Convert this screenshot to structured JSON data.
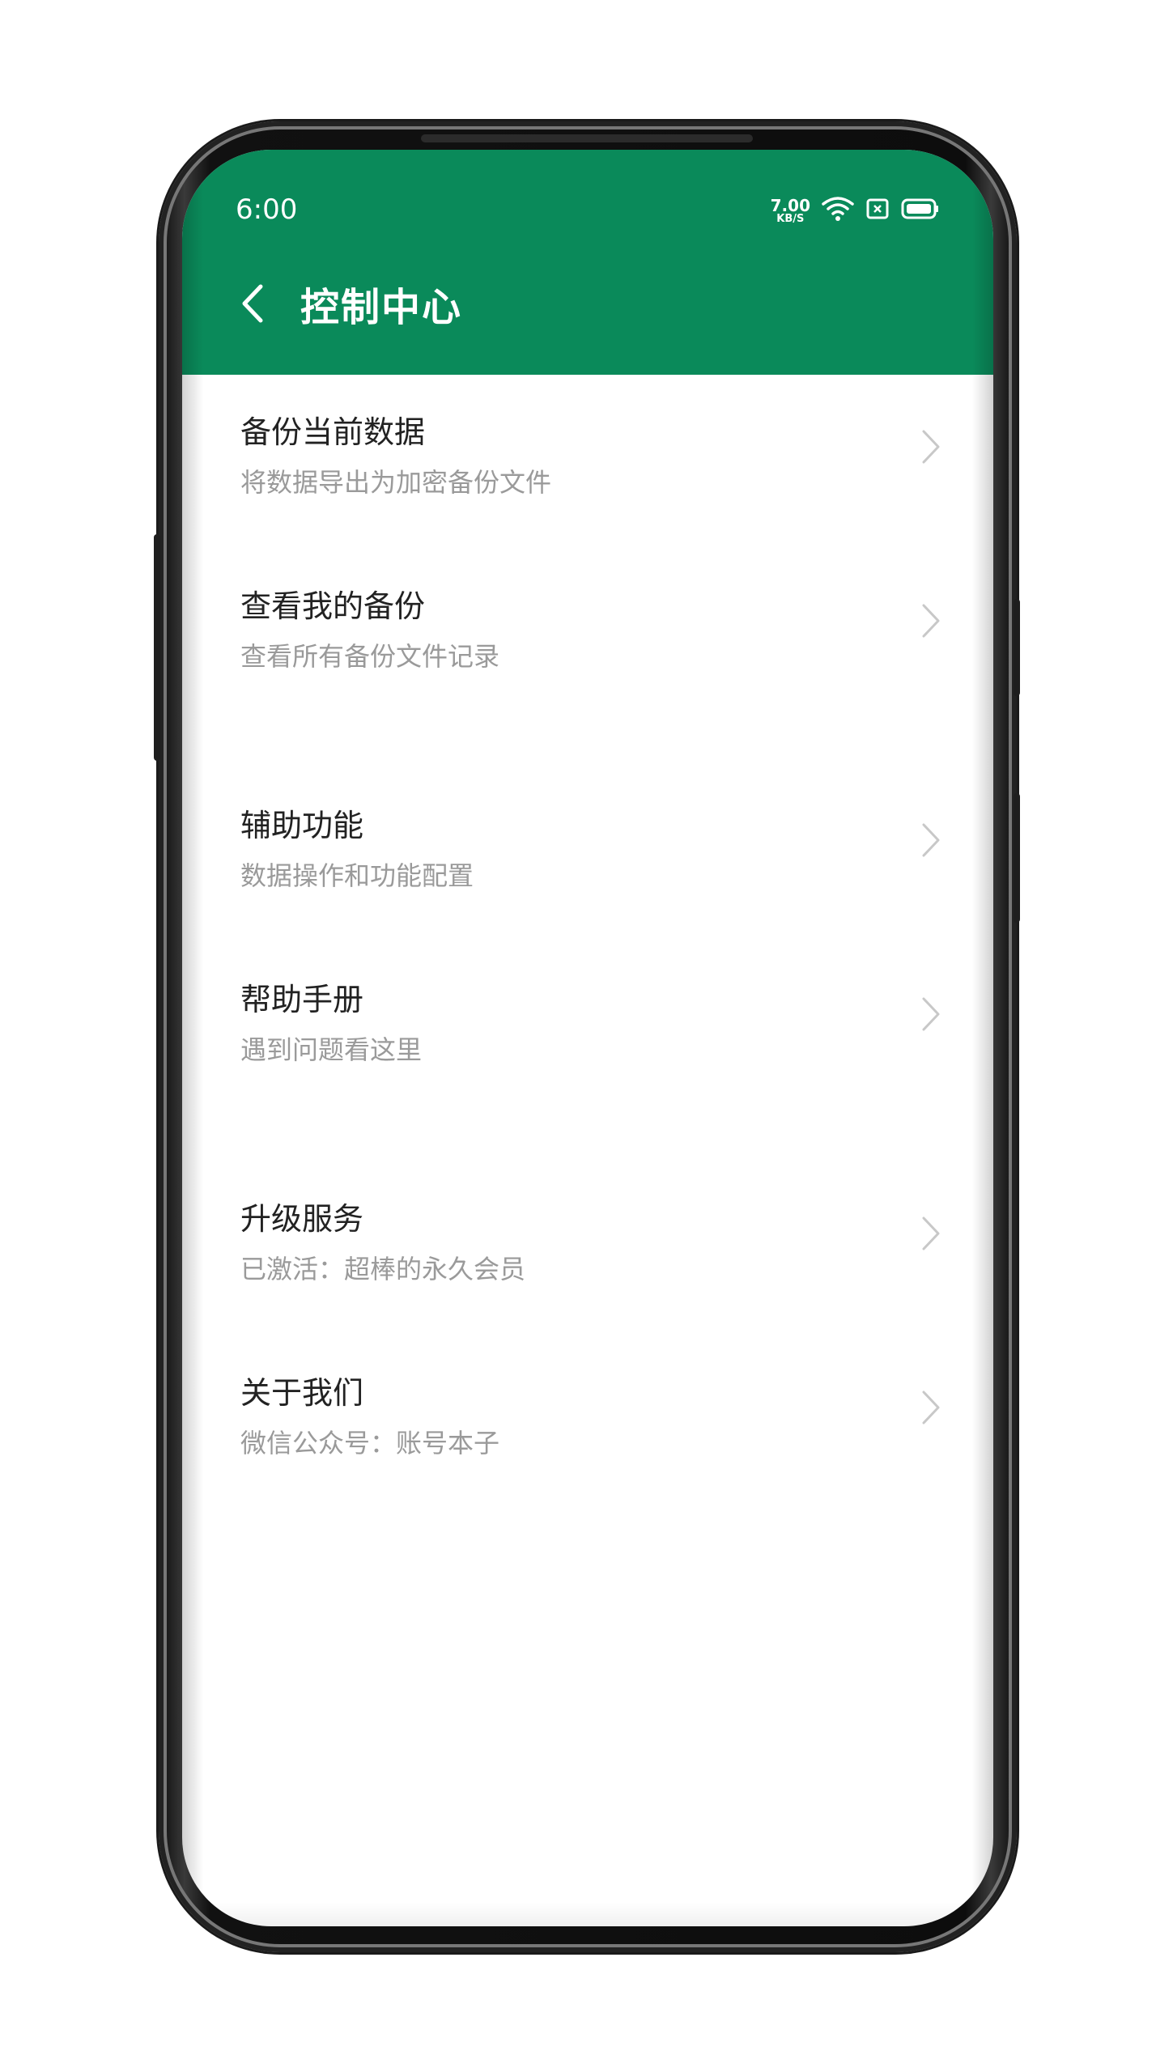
{
  "status_bar": {
    "time": "6:00",
    "net_speed_value": "7.00",
    "net_speed_unit": "KB/S",
    "icons": [
      "wifi-icon",
      "sim-card-icon",
      "battery-icon"
    ]
  },
  "header": {
    "title": "控制中心",
    "background_color": "#0a8a5a"
  },
  "menu": {
    "items": [
      {
        "title": "备份当前数据",
        "subtitle": "将数据导出为加密备份文件"
      },
      {
        "title": "查看我的备份",
        "subtitle": "查看所有备份文件记录"
      },
      {
        "title": "辅助功能",
        "subtitle": "数据操作和功能配置"
      },
      {
        "title": "帮助手册",
        "subtitle": "遇到问题看这里"
      },
      {
        "title": "升级服务",
        "subtitle": "已激活：超棒的永久会员"
      },
      {
        "title": "关于我们",
        "subtitle": "微信公众号：账号本子"
      }
    ]
  }
}
